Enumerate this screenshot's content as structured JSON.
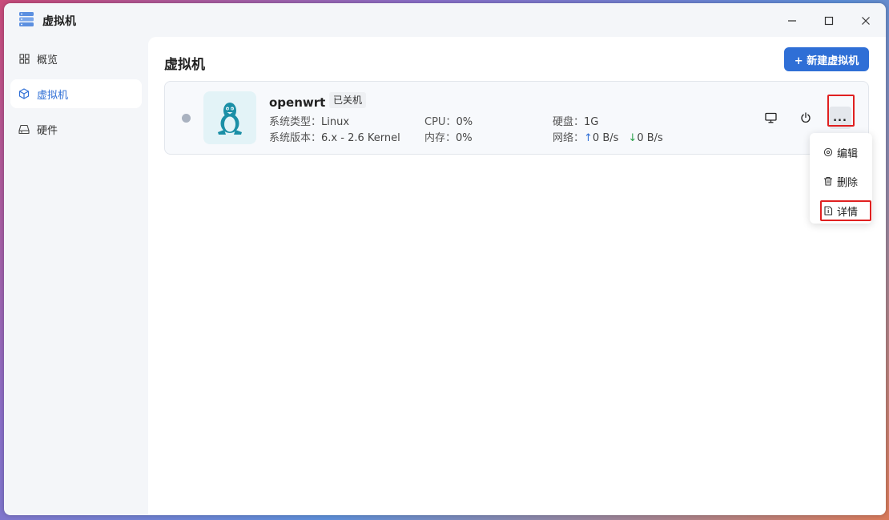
{
  "window": {
    "title": "虚拟机"
  },
  "sidebar": {
    "items": [
      {
        "label": "概览",
        "icon": "grid-icon",
        "active": false
      },
      {
        "label": "虚拟机",
        "icon": "cube-icon",
        "active": true
      },
      {
        "label": "硬件",
        "icon": "drive-icon",
        "active": false
      }
    ]
  },
  "main": {
    "title": "虚拟机",
    "new_button": "+ 新建虚拟机"
  },
  "vm": {
    "name": "openwrt",
    "status": "已关机",
    "status_color": "#a9b2c0",
    "os_type_label": "系统类型：",
    "os_type": "Linux",
    "os_version_label": "系统版本：",
    "os_version": "6.x - 2.6 Kernel",
    "cpu_label": "CPU：",
    "cpu": "0%",
    "memory_label": "内存：",
    "memory": "0%",
    "disk_label": "硬盘：",
    "disk": "1G",
    "network_label": "网络：",
    "net_up": "0 B/s",
    "net_down": "0 B/s",
    "more_label": "..."
  },
  "menu": {
    "items": [
      {
        "label": "编辑",
        "icon": "edit-icon"
      },
      {
        "label": "删除",
        "icon": "trash-icon"
      },
      {
        "label": "详情",
        "icon": "detail-icon"
      }
    ]
  },
  "colors": {
    "accent": "#2f6fd6",
    "highlight": "#e02020",
    "upload": "#2f6fd6",
    "download": "#2aa04a"
  }
}
